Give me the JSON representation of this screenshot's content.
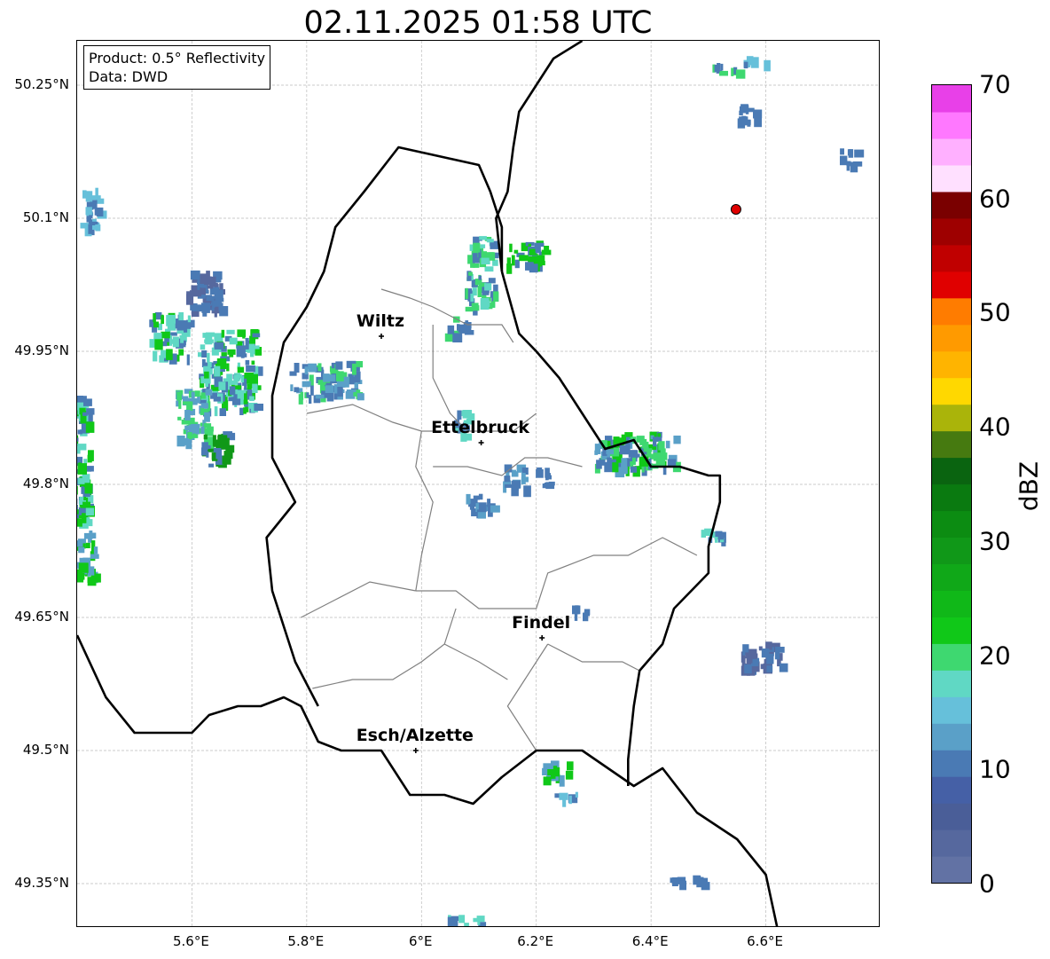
{
  "title": "02.11.2025 01:58 UTC",
  "info": {
    "product": "Product: 0.5° Reflectivity",
    "data": "Data: DWD"
  },
  "axes": {
    "lon_min": 5.4,
    "lon_max": 6.8,
    "lat_min": 49.3,
    "lat_max": 50.3,
    "x_ticks": [
      {
        "value": 5.6,
        "label": "5.6°E"
      },
      {
        "value": 5.8,
        "label": "5.8°E"
      },
      {
        "value": 6.0,
        "label": "6°E"
      },
      {
        "value": 6.2,
        "label": "6.2°E"
      },
      {
        "value": 6.4,
        "label": "6.4°E"
      },
      {
        "value": 6.6,
        "label": "6.6°E"
      }
    ],
    "y_ticks": [
      {
        "value": 50.25,
        "label": "50.25°N"
      },
      {
        "value": 50.1,
        "label": "50.1°N"
      },
      {
        "value": 49.95,
        "label": "49.95°N"
      },
      {
        "value": 49.8,
        "label": "49.8°N"
      },
      {
        "value": 49.65,
        "label": "49.65°N"
      },
      {
        "value": 49.5,
        "label": "49.5°N"
      },
      {
        "value": 49.35,
        "label": "49.35°N"
      }
    ],
    "grid": true
  },
  "cities": [
    {
      "name": "Wiltz",
      "lon": 5.93,
      "lat": 49.967
    },
    {
      "name": "Ettelbruck",
      "lon": 6.104,
      "lat": 49.847
    },
    {
      "name": "Findel",
      "lon": 6.21,
      "lat": 49.627
    },
    {
      "name": "Esch/Alzette",
      "lon": 5.99,
      "lat": 49.5
    }
  ],
  "radar_site": {
    "lon": 6.548,
    "lat": 50.11,
    "color": "#e00000"
  },
  "colorbar": {
    "label": "dBZ",
    "min": 0,
    "max": 70,
    "ticks": [
      "0",
      "10",
      "20",
      "30",
      "40",
      "50",
      "60",
      "70"
    ],
    "colors": [
      "#6272a4",
      "#56689e",
      "#4a5e98",
      "#4560a6",
      "#4a7ab4",
      "#5aa0c8",
      "#66c0da",
      "#60d8c4",
      "#3ed870",
      "#10c818",
      "#10b818",
      "#10a818",
      "#109818",
      "#0c8c12",
      "#0a7a10",
      "#0a6410",
      "#467a10",
      "#aab40a",
      "#ffd800",
      "#ffb400",
      "#ff9a00",
      "#ff7c00",
      "#e00000",
      "#c00000",
      "#9e0000",
      "#7a0000",
      "#ffe0ff",
      "#ffb0ff",
      "#ff78ff",
      "#e840e8"
    ]
  },
  "echoes": [
    {
      "lon": 5.36,
      "lat": 49.83,
      "w": 0.12,
      "h": 0.14,
      "c": [
        "#4a7ab4",
        "#60d8c4",
        "#10c818"
      ]
    },
    {
      "lon": 5.41,
      "lat": 49.72,
      "w": 0.04,
      "h": 0.06,
      "c": [
        "#5aa0c8",
        "#10c818"
      ]
    },
    {
      "lon": 5.62,
      "lat": 50.02,
      "w": 0.06,
      "h": 0.05,
      "c": [
        "#4a7ab4",
        "#56689e"
      ]
    },
    {
      "lon": 5.56,
      "lat": 49.97,
      "w": 0.07,
      "h": 0.05,
      "c": [
        "#4a7ab4",
        "#10c818",
        "#60d8c4"
      ]
    },
    {
      "lon": 5.66,
      "lat": 49.93,
      "w": 0.1,
      "h": 0.09,
      "c": [
        "#4a7ab4",
        "#60d8c4",
        "#10c818"
      ]
    },
    {
      "lon": 5.6,
      "lat": 49.88,
      "w": 0.06,
      "h": 0.06,
      "c": [
        "#5aa0c8",
        "#3ed870"
      ]
    },
    {
      "lon": 5.64,
      "lat": 49.84,
      "w": 0.05,
      "h": 0.04,
      "c": [
        "#4a7ab4",
        "#109818"
      ]
    },
    {
      "lon": 5.42,
      "lat": 50.11,
      "w": 0.03,
      "h": 0.05,
      "c": [
        "#4a7ab4",
        "#66c0da"
      ]
    },
    {
      "lon": 5.83,
      "lat": 49.92,
      "w": 0.12,
      "h": 0.04,
      "c": [
        "#4a7ab4",
        "#5aa0c8",
        "#3ed870"
      ]
    },
    {
      "lon": 6.1,
      "lat": 50.04,
      "w": 0.05,
      "h": 0.08,
      "c": [
        "#4a7ab4",
        "#3ed870",
        "#60d8c4"
      ]
    },
    {
      "lon": 6.18,
      "lat": 50.06,
      "w": 0.07,
      "h": 0.03,
      "c": [
        "#4a7ab4",
        "#10c818"
      ]
    },
    {
      "lon": 6.06,
      "lat": 49.98,
      "w": 0.04,
      "h": 0.02,
      "c": [
        "#4a7ab4",
        "#3ed870"
      ]
    },
    {
      "lon": 6.07,
      "lat": 49.87,
      "w": 0.03,
      "h": 0.03,
      "c": [
        "#4a7ab4",
        "#60d8c4"
      ]
    },
    {
      "lon": 6.37,
      "lat": 49.84,
      "w": 0.14,
      "h": 0.04,
      "c": [
        "#4a7ab4",
        "#3ed870",
        "#10c818",
        "#5aa0c8"
      ]
    },
    {
      "lon": 6.16,
      "lat": 49.81,
      "w": 0.04,
      "h": 0.03,
      "c": [
        "#4a7ab4",
        "#5aa0c8"
      ]
    },
    {
      "lon": 6.21,
      "lat": 49.81,
      "w": 0.03,
      "h": 0.02,
      "c": [
        "#4a7ab4"
      ]
    },
    {
      "lon": 6.1,
      "lat": 49.78,
      "w": 0.05,
      "h": 0.02,
      "c": [
        "#4a7ab4",
        "#5aa0c8"
      ]
    },
    {
      "lon": 6.51,
      "lat": 49.745,
      "w": 0.05,
      "h": 0.015,
      "c": [
        "#4a7ab4",
        "#60d8c4"
      ]
    },
    {
      "lon": 6.59,
      "lat": 49.61,
      "w": 0.07,
      "h": 0.03,
      "c": [
        "#4a7ab4",
        "#56689e"
      ]
    },
    {
      "lon": 6.27,
      "lat": 49.66,
      "w": 0.03,
      "h": 0.01,
      "c": [
        "#4a7ab4"
      ]
    },
    {
      "lon": 6.23,
      "lat": 49.48,
      "w": 0.05,
      "h": 0.02,
      "c": [
        "#5aa0c8",
        "#10c818"
      ]
    },
    {
      "lon": 6.25,
      "lat": 49.45,
      "w": 0.04,
      "h": 0.01,
      "c": [
        "#66c0da",
        "#4a7ab4"
      ]
    },
    {
      "lon": 6.46,
      "lat": 49.355,
      "w": 0.06,
      "h": 0.01,
      "c": [
        "#4a7ab4"
      ]
    },
    {
      "lon": 6.07,
      "lat": 49.31,
      "w": 0.06,
      "h": 0.01,
      "c": [
        "#4a7ab4",
        "#60d8c4"
      ]
    },
    {
      "lon": 6.52,
      "lat": 50.27,
      "w": 0.06,
      "h": 0.01,
      "c": [
        "#4a7ab4",
        "#3ed870"
      ]
    },
    {
      "lon": 6.57,
      "lat": 50.22,
      "w": 0.04,
      "h": 0.02,
      "c": [
        "#4a7ab4"
      ]
    },
    {
      "lon": 6.74,
      "lat": 50.17,
      "w": 0.03,
      "h": 0.02,
      "c": [
        "#4a7ab4"
      ]
    },
    {
      "lon": 6.58,
      "lat": 50.28,
      "w": 0.04,
      "h": 0.01,
      "c": [
        "#4a7ab4",
        "#66c0da"
      ]
    }
  ],
  "borders": {
    "national": [
      [
        [
          5.4,
          49.63
        ],
        [
          5.45,
          49.56
        ],
        [
          5.5,
          49.52
        ],
        [
          5.55,
          49.52
        ],
        [
          5.6,
          49.52
        ],
        [
          5.63,
          49.54
        ],
        [
          5.68,
          49.55
        ],
        [
          5.72,
          49.55
        ],
        [
          5.76,
          49.56
        ],
        [
          5.79,
          49.55
        ],
        [
          5.82,
          49.51
        ],
        [
          5.86,
          49.5
        ],
        [
          5.93,
          49.5
        ],
        [
          5.98,
          49.45
        ],
        [
          6.04,
          49.45
        ],
        [
          6.09,
          49.44
        ],
        [
          6.14,
          49.47
        ],
        [
          6.2,
          49.5
        ],
        [
          6.28,
          49.5
        ],
        [
          6.37,
          49.46
        ],
        [
          6.42,
          49.48
        ],
        [
          6.48,
          49.43
        ],
        [
          6.55,
          49.4
        ],
        [
          6.6,
          49.36
        ],
        [
          6.62,
          49.3
        ]
      ],
      [
        [
          5.82,
          49.55
        ],
        [
          5.78,
          49.6
        ],
        [
          5.74,
          49.68
        ],
        [
          5.73,
          49.74
        ],
        [
          5.78,
          49.78
        ],
        [
          5.74,
          49.83
        ],
        [
          5.74,
          49.9
        ],
        [
          5.76,
          49.96
        ],
        [
          5.8,
          50.0
        ],
        [
          5.83,
          50.04
        ],
        [
          5.85,
          50.09
        ],
        [
          5.9,
          50.13
        ],
        [
          5.96,
          50.18
        ],
        [
          6.03,
          50.17
        ],
        [
          6.1,
          50.16
        ],
        [
          6.12,
          50.13
        ],
        [
          6.14,
          50.09
        ],
        [
          6.14,
          50.04
        ]
      ],
      [
        [
          6.14,
          50.04
        ],
        [
          6.17,
          49.97
        ],
        [
          6.2,
          49.95
        ],
        [
          6.24,
          49.92
        ],
        [
          6.28,
          49.88
        ],
        [
          6.32,
          49.84
        ],
        [
          6.37,
          49.85
        ],
        [
          6.4,
          49.82
        ],
        [
          6.45,
          49.82
        ],
        [
          6.5,
          49.81
        ],
        [
          6.52,
          49.81
        ],
        [
          6.52,
          49.78
        ],
        [
          6.5,
          49.73
        ],
        [
          6.5,
          49.7
        ],
        [
          6.44,
          49.66
        ],
        [
          6.42,
          49.62
        ],
        [
          6.38,
          49.59
        ],
        [
          6.37,
          49.55
        ],
        [
          6.36,
          49.49
        ],
        [
          6.36,
          49.46
        ]
      ],
      [
        [
          6.14,
          50.04
        ],
        [
          6.13,
          50.1
        ],
        [
          6.15,
          50.13
        ],
        [
          6.16,
          50.18
        ],
        [
          6.17,
          50.22
        ],
        [
          6.2,
          50.25
        ],
        [
          6.23,
          50.28
        ],
        [
          6.28,
          50.3
        ]
      ]
    ],
    "cantonal": [
      [
        [
          5.93,
          50.02
        ],
        [
          5.98,
          50.01
        ],
        [
          6.02,
          50.0
        ],
        [
          6.05,
          49.99
        ],
        [
          6.08,
          49.98
        ],
        [
          6.14,
          49.98
        ],
        [
          6.16,
          49.96
        ]
      ],
      [
        [
          6.02,
          49.98
        ],
        [
          6.02,
          49.92
        ],
        [
          6.05,
          49.88
        ],
        [
          6.08,
          49.86
        ],
        [
          6.12,
          49.86
        ],
        [
          6.16,
          49.86
        ],
        [
          6.2,
          49.88
        ]
      ],
      [
        [
          5.8,
          49.88
        ],
        [
          5.88,
          49.89
        ],
        [
          5.95,
          49.87
        ],
        [
          6.0,
          49.86
        ],
        [
          6.05,
          49.86
        ]
      ],
      [
        [
          6.0,
          49.86
        ],
        [
          5.99,
          49.82
        ],
        [
          6.02,
          49.78
        ],
        [
          6.0,
          49.72
        ],
        [
          5.99,
          49.68
        ]
      ],
      [
        [
          6.02,
          49.82
        ],
        [
          6.08,
          49.82
        ],
        [
          6.14,
          49.81
        ],
        [
          6.18,
          49.83
        ],
        [
          6.22,
          49.83
        ],
        [
          6.28,
          49.82
        ]
      ],
      [
        [
          5.99,
          49.68
        ],
        [
          6.06,
          49.68
        ],
        [
          6.1,
          49.66
        ],
        [
          6.16,
          49.66
        ],
        [
          6.2,
          49.66
        ],
        [
          6.22,
          49.7
        ],
        [
          6.3,
          49.72
        ],
        [
          6.36,
          49.72
        ],
        [
          6.42,
          49.74
        ],
        [
          6.48,
          49.72
        ]
      ],
      [
        [
          5.79,
          49.65
        ],
        [
          5.85,
          49.67
        ],
        [
          5.91,
          49.69
        ],
        [
          5.99,
          49.68
        ]
      ],
      [
        [
          6.06,
          49.66
        ],
        [
          6.04,
          49.62
        ],
        [
          6.0,
          49.6
        ],
        [
          5.95,
          49.58
        ],
        [
          5.88,
          49.58
        ],
        [
          5.81,
          49.57
        ]
      ],
      [
        [
          6.22,
          49.62
        ],
        [
          6.28,
          49.6
        ],
        [
          6.35,
          49.6
        ],
        [
          6.38,
          49.59
        ]
      ],
      [
        [
          6.22,
          49.62
        ],
        [
          6.18,
          49.58
        ],
        [
          6.15,
          49.55
        ],
        [
          6.2,
          49.5
        ]
      ],
      [
        [
          6.04,
          49.62
        ],
        [
          6.1,
          49.6
        ],
        [
          6.15,
          49.58
        ]
      ]
    ]
  }
}
